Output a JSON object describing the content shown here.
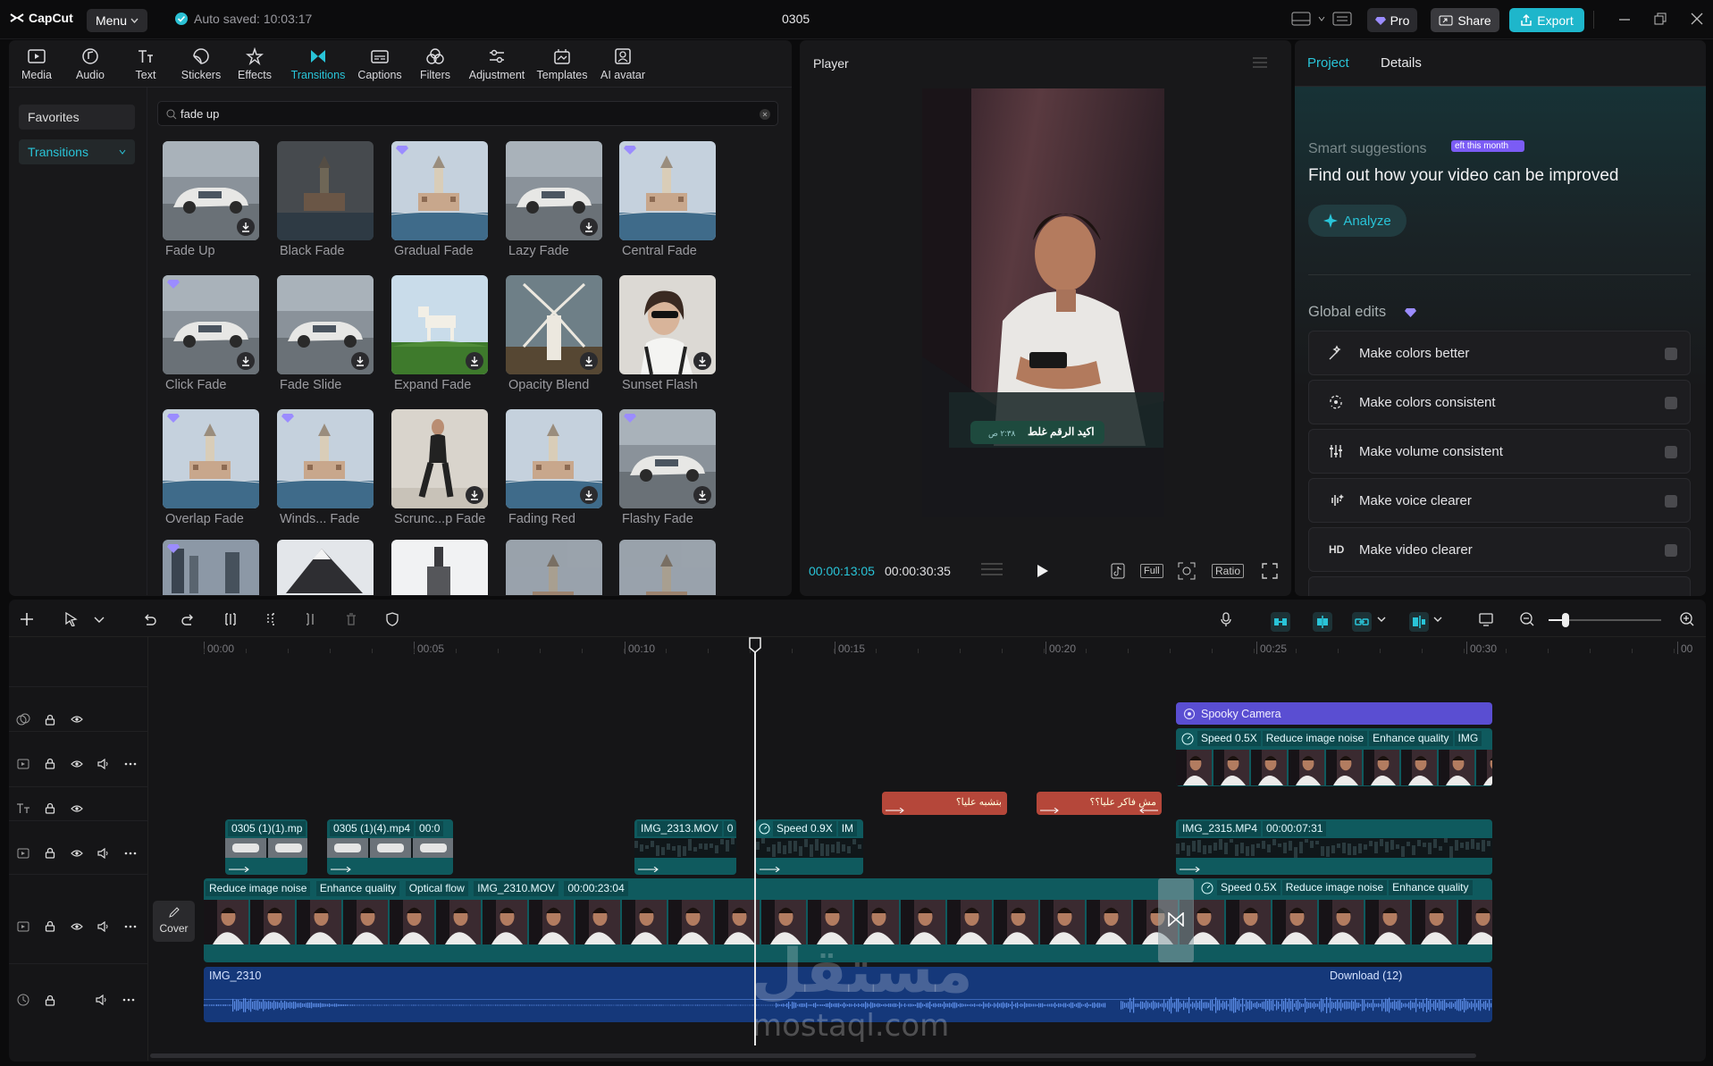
{
  "app": {
    "logo_text": "CapCut",
    "menu_label": "Menu",
    "autosave": "Auto saved: 10:03:17",
    "project_name": "0305",
    "pro_label": "Pro",
    "share_label": "Share",
    "export_label": "Export",
    "accent": "#29c4d8"
  },
  "toolbar": {
    "items": [
      {
        "label": "Media",
        "icon": "media-icon"
      },
      {
        "label": "Audio",
        "icon": "audio-icon"
      },
      {
        "label": "Text",
        "icon": "text-icon"
      },
      {
        "label": "Stickers",
        "icon": "stickers-icon"
      },
      {
        "label": "Effects",
        "icon": "effects-icon"
      },
      {
        "label": "Transitions",
        "icon": "transitions-icon",
        "active": true
      },
      {
        "label": "Captions",
        "icon": "captions-icon"
      },
      {
        "label": "Filters",
        "icon": "filters-icon"
      },
      {
        "label": "Adjustment",
        "icon": "adjustment-icon"
      },
      {
        "label": "Templates",
        "icon": "templates-icon"
      },
      {
        "label": "AI avatar",
        "icon": "ai-avatar-icon"
      }
    ]
  },
  "sidebar": {
    "favorites": "Favorites",
    "transitions": "Transitions"
  },
  "search": {
    "value": "fade up"
  },
  "transitions": [
    {
      "label": "Fade Up",
      "scene": "car",
      "pro": false,
      "download": true
    },
    {
      "label": "Black Fade",
      "scene": "tower-dark",
      "pro": false,
      "download": false
    },
    {
      "label": "Gradual Fade",
      "scene": "tower",
      "pro": true,
      "download": false
    },
    {
      "label": "Lazy Fade",
      "scene": "car",
      "pro": false,
      "download": true
    },
    {
      "label": "Central Fade",
      "scene": "tower",
      "pro": true,
      "download": false
    },
    {
      "label": "Click Fade",
      "scene": "car",
      "pro": true,
      "download": true
    },
    {
      "label": "Fade Slide",
      "scene": "car",
      "pro": false,
      "download": true
    },
    {
      "label": "Expand Fade",
      "scene": "field",
      "pro": false,
      "download": true
    },
    {
      "label": "Opacity Blend",
      "scene": "windmill",
      "pro": false,
      "download": true
    },
    {
      "label": "Sunset Flash",
      "scene": "portrait",
      "pro": false,
      "download": true
    },
    {
      "label": "Overlap Fade",
      "scene": "tower",
      "pro": true,
      "download": false
    },
    {
      "label": "Winds... Fade",
      "scene": "tower",
      "pro": true,
      "download": false
    },
    {
      "label": "Scrunc...p Fade",
      "scene": "fashion",
      "pro": false,
      "download": true
    },
    {
      "label": "Fading Red",
      "scene": "tower",
      "pro": false,
      "download": true
    },
    {
      "label": "Flashy Fade",
      "scene": "car",
      "pro": true,
      "download": true
    }
  ],
  "player": {
    "title": "Player",
    "current_time": "00:00:13:05",
    "total_time": "00:00:30:35",
    "full_label": "Full",
    "ratio_label": "Ratio",
    "caption_text": "اكيد الرقم غلط",
    "caption_time": "٢:٣٨ ص"
  },
  "right_panel": {
    "tab_project": "Project",
    "tab_details": "Details",
    "smart_suggestions": "Smart suggestions",
    "badge": "eft this month",
    "headline": "Find out how your video can be improved",
    "analyze": "Analyze",
    "global_edits": "Global edits",
    "edits": [
      {
        "label": "Make colors better",
        "icon": "magic-wand-icon"
      },
      {
        "label": "Make colors consistent",
        "icon": "color-sync-icon"
      },
      {
        "label": "Make volume consistent",
        "icon": "sliders-icon"
      },
      {
        "label": "Make voice clearer",
        "icon": "voice-wave-icon"
      },
      {
        "label": "Make video clearer",
        "icon": "hd-icon"
      }
    ]
  },
  "timeline": {
    "ruler": [
      "00:00",
      "00:05",
      "00:10",
      "00:15",
      "00:20",
      "00:25",
      "00:30",
      "00"
    ],
    "cover_label": "Cover",
    "effect_clip": "Spooky Camera",
    "overlay_tags": [
      "Speed 0.5X",
      "Reduce image noise",
      "Enhance quality",
      "IMG"
    ],
    "text_clips": [
      "بتشبه عليا؟",
      "مش فاكر عليا؟؟"
    ],
    "clips_row": [
      {
        "name": "0305 (1)(1).mp"
      },
      {
        "name": "0305 (1)(4).mp4",
        "extra": "00:0"
      },
      {
        "name": "IMG_2313.MOV",
        "extra": "0"
      },
      {
        "name": "Speed 0.9X",
        "extra": "IM"
      },
      {
        "name": "IMG_2315.MP4",
        "extra": "00:00:07:31"
      }
    ],
    "main_tags": [
      "Reduce image noise",
      "Enhance quality",
      "Optical flow",
      "IMG_2310.MOV",
      "00:00:23:04"
    ],
    "main_tags2": [
      "Speed 0.5X",
      "Reduce image noise",
      "Enhance quality"
    ],
    "audio1": "IMG_2310",
    "audio2": "Download (12)",
    "watermark_ar": "مستقل",
    "watermark_en": "mostaql.com"
  }
}
